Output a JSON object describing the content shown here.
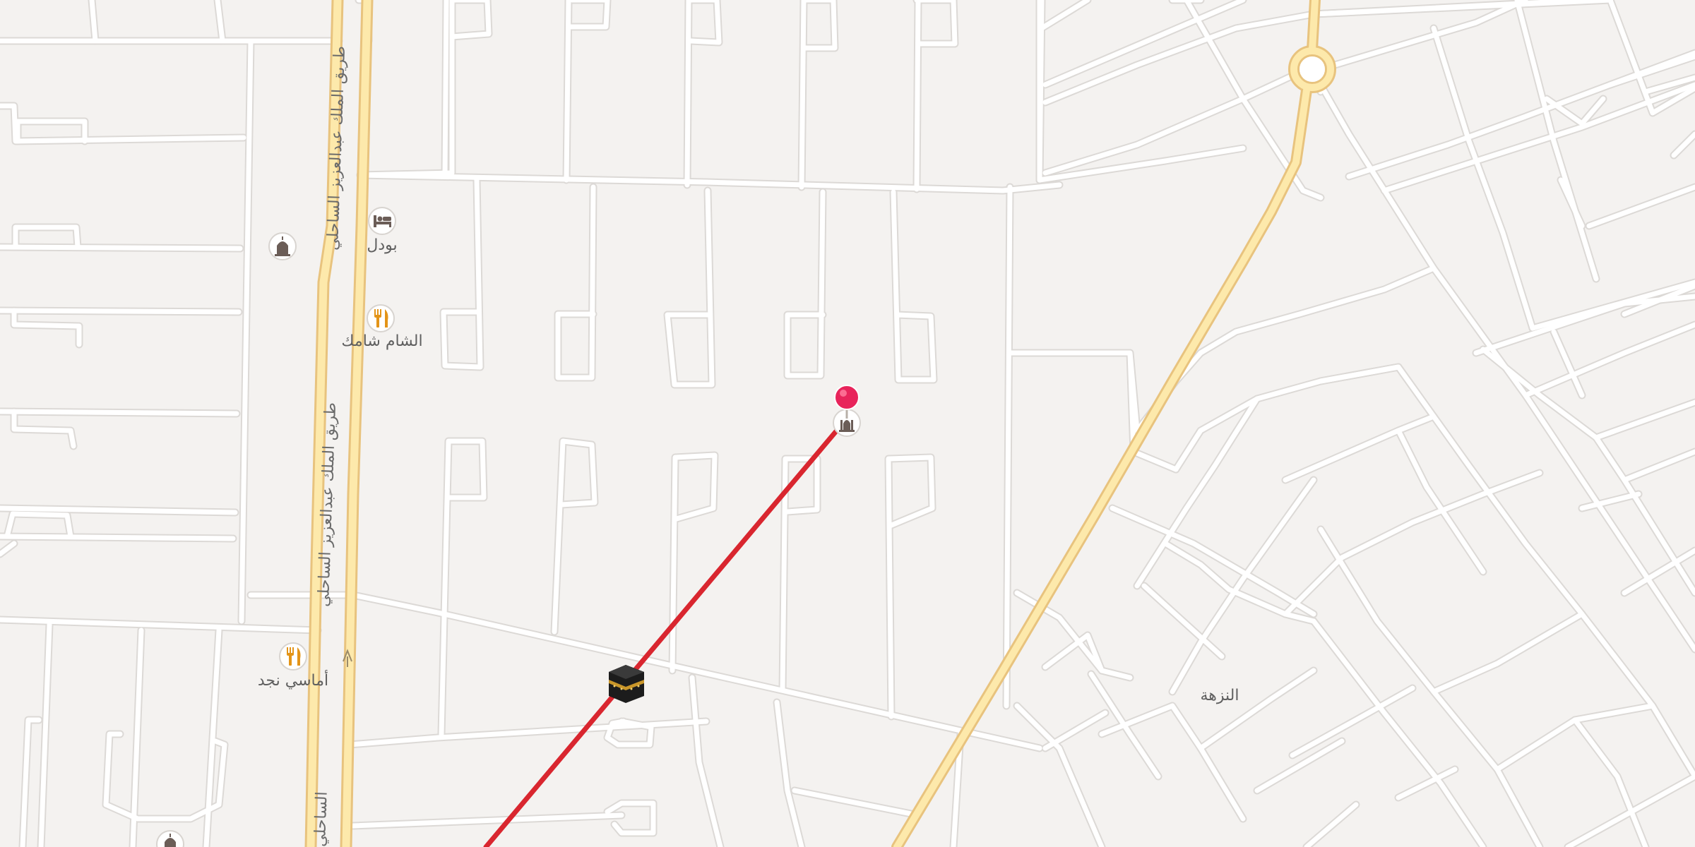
{
  "map": {
    "accent_color": "#d9262f",
    "pin_color": "#e8245b",
    "main_road_color": "#fde9ab",
    "qibla_line": {
      "from": "map-pin",
      "to": "kaaba-icon",
      "color": "#d9262f"
    }
  },
  "labels": {
    "hotel": "بودل",
    "restaurant_1": "الشام شامك",
    "restaurant_2": "أماسي نجد",
    "district": "النزهة",
    "road_upper": "طريق الملك عبدالعزيز الساحلي",
    "road_lower": "طريق الملك عبدالعزيز الساحلي",
    "road_bottom": "الساحلي"
  },
  "pois": [
    {
      "type": "hotel",
      "icon": "bed-icon"
    },
    {
      "type": "restaurant",
      "icon": "fork-knife-icon"
    },
    {
      "type": "restaurant",
      "icon": "fork-knife-icon"
    },
    {
      "type": "mosque",
      "icon": "mosque-icon"
    },
    {
      "type": "mosque",
      "icon": "mosque-icon"
    },
    {
      "type": "mosque",
      "icon": "mosque-icon"
    },
    {
      "type": "selected-location",
      "icon": "map-pin-icon"
    },
    {
      "type": "qibla-target",
      "icon": "kaaba-icon"
    }
  ]
}
